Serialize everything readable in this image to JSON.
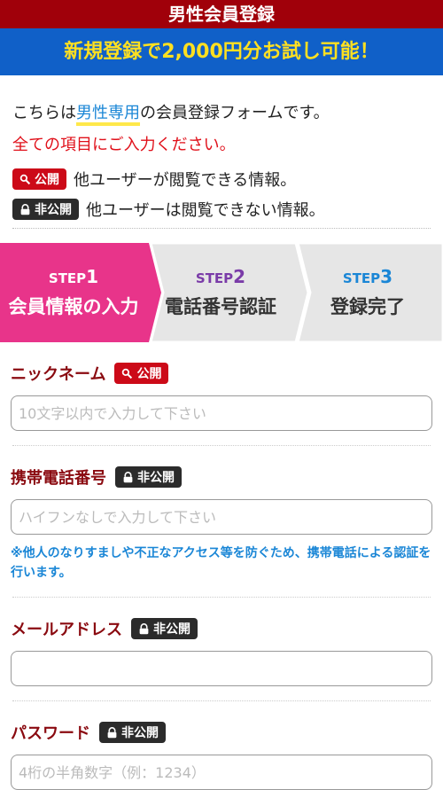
{
  "header": {
    "title": "男性会員登録",
    "banner": "新規登録で2,000円分お試し可能！"
  },
  "intro": {
    "line1_pre": "こちらは",
    "line1_highlight": "男性専用",
    "line1_post": "の会員登録フォームです。",
    "required_notice": "全ての項目にご入力ください。"
  },
  "legend": {
    "public_badge": "公開",
    "public_text": "他ユーザーが閲覧できる情報。",
    "private_badge": "非公開",
    "private_text": "他ユーザーは閲覧できない情報。"
  },
  "steps": [
    {
      "step": "STEP",
      "num": "1",
      "label": "会員情報の入力"
    },
    {
      "step": "STEP",
      "num": "2",
      "label": "電話番号認証"
    },
    {
      "step": "STEP",
      "num": "3",
      "label": "登録完了"
    }
  ],
  "colors": {
    "header_bg": "#a0000a",
    "banner_bg": "#1060c8",
    "step_active": "#e8348a",
    "step_inactive": "#e6e6e6"
  },
  "fields": {
    "nickname": {
      "label": "ニックネーム",
      "badge": "公開",
      "placeholder": "10文字以内で入力して下さい"
    },
    "phone": {
      "label": "携帯電話番号",
      "badge": "非公開",
      "placeholder": "ハイフンなしで入力して下さい",
      "note": "※他人のなりすましや不正なアクセス等を防ぐため、携帯電話による認証を行います。"
    },
    "email": {
      "label": "メールアドレス",
      "badge": "非公開",
      "placeholder": ""
    },
    "password": {
      "label": "パスワード",
      "badge": "非公開",
      "placeholder": "4桁の半角数字（例：1234）"
    }
  }
}
